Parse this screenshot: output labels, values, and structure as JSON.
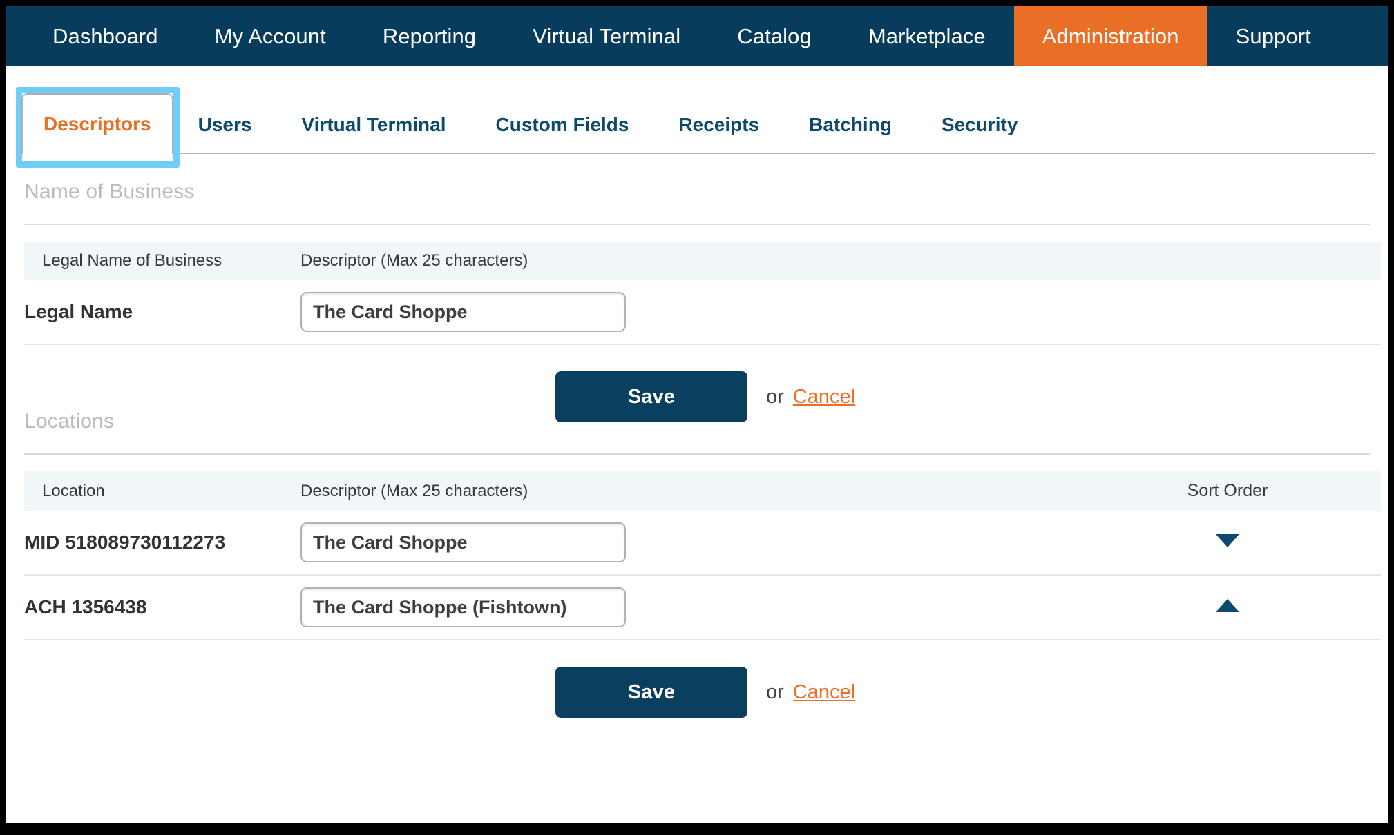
{
  "colors": {
    "navy": "#083c5c",
    "orange": "#e96e26",
    "button_navy": "#0b3f5f",
    "header_row_bg": "#f1f6f9",
    "section_title_grey": "#b7bcbf",
    "highlight_cyan": "#6fcdf8"
  },
  "topnav": {
    "items": [
      {
        "label": "Dashboard",
        "active": false
      },
      {
        "label": "My Account",
        "active": false
      },
      {
        "label": "Reporting",
        "active": false
      },
      {
        "label": "Virtual Terminal",
        "active": false
      },
      {
        "label": "Catalog",
        "active": false
      },
      {
        "label": "Marketplace",
        "active": false
      },
      {
        "label": "Administration",
        "active": true
      },
      {
        "label": "Support",
        "active": false
      }
    ]
  },
  "tabs": [
    {
      "label": "Descriptors",
      "selected": true
    },
    {
      "label": "Users",
      "selected": false
    },
    {
      "label": "Virtual Terminal",
      "selected": false
    },
    {
      "label": "Custom Fields",
      "selected": false
    },
    {
      "label": "Receipts",
      "selected": false
    },
    {
      "label": "Batching",
      "selected": false
    },
    {
      "label": "Security",
      "selected": false
    }
  ],
  "business_section": {
    "title": "Name of Business",
    "columns": {
      "name": "Legal Name of Business",
      "descriptor": "Descriptor (Max 25 characters)"
    },
    "rows": [
      {
        "label": "Legal Name",
        "descriptor_value": "The Card Shoppe",
        "descriptor_placeholder": "Descriptor"
      }
    ],
    "actions": {
      "save_label": "Save",
      "or_label": "or",
      "cancel_label": "Cancel"
    }
  },
  "locations_section": {
    "title": "Locations",
    "columns": {
      "location": "Location",
      "descriptor": "Descriptor (Max 25 characters)",
      "sort_order": "Sort Order"
    },
    "rows": [
      {
        "label": "MID 518089730112273",
        "descriptor_value": "The Card Shoppe",
        "descriptor_placeholder": "Descriptor",
        "sort_icon": "chevron-down-icon"
      },
      {
        "label": "ACH 1356438",
        "descriptor_value": "The Card Shoppe (Fishtown)",
        "descriptor_placeholder": "Descriptor",
        "sort_icon": "chevron-up-icon"
      }
    ],
    "actions": {
      "save_label": "Save",
      "or_label": "or",
      "cancel_label": "Cancel"
    }
  }
}
